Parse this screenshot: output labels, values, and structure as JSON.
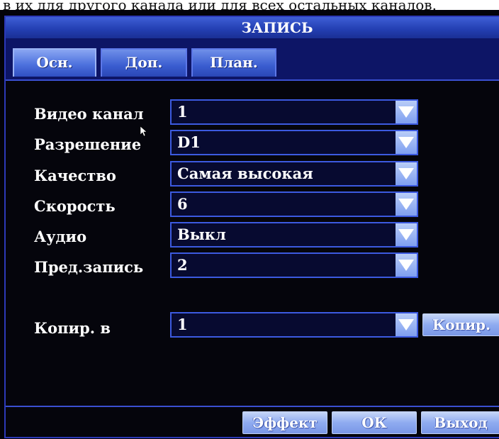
{
  "caption": "в их для другого канала или для всех остальных каналов.",
  "window": {
    "title": "ЗАПИСЬ"
  },
  "tabs": [
    {
      "label": "Осн.",
      "active": true
    },
    {
      "label": "Доп.",
      "active": false
    },
    {
      "label": "План.",
      "active": false
    }
  ],
  "form": {
    "fields": [
      {
        "label": "Видео канал",
        "value": "1"
      },
      {
        "label": "Разрешение",
        "value": "D1"
      },
      {
        "label": "Качество",
        "value": "Самая высокая"
      },
      {
        "label": "Скорость",
        "value": "6"
      },
      {
        "label": "Аудио",
        "value": "Выкл"
      },
      {
        "label": "Пред.запись",
        "value": "2"
      }
    ],
    "copy": {
      "label": "Копир. в",
      "value": "1",
      "button_label": "Копир."
    }
  },
  "footer": {
    "effect_label": "Эффект",
    "ok_label": "ОК",
    "exit_label": "Выход"
  },
  "colors": {
    "title_bar": "#2a47b6",
    "field_border": "#3c5ae0",
    "button_fill": "#8fabf0"
  }
}
